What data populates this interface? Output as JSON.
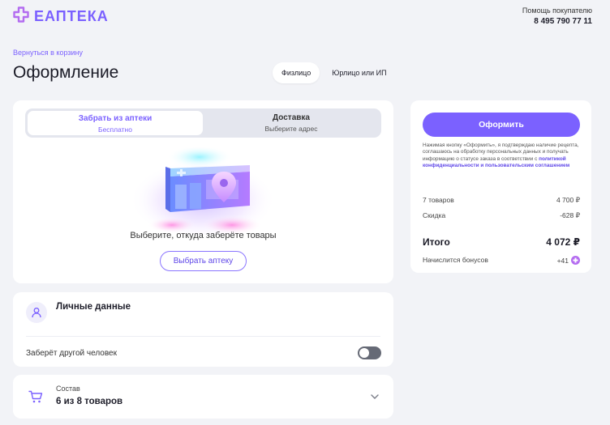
{
  "header": {
    "logo_text": "ЕАПТЕКА",
    "help_label": "Помощь покупателю",
    "phone": "8 495 790 77 11"
  },
  "breadcrumb": {
    "back_label": "Вернуться в корзину"
  },
  "page": {
    "title": "Оформление"
  },
  "person_tabs": [
    {
      "label": "Физлицо",
      "active": true
    },
    {
      "label": "Юрлицо или ИП",
      "active": false
    }
  ],
  "delivery": {
    "options": [
      {
        "title": "Забрать из аптеки",
        "subtitle": "Бесплатно",
        "active": true
      },
      {
        "title": "Доставка",
        "subtitle": "Выберите адрес",
        "active": false
      }
    ],
    "prompt": "Выберите, откуда заберёте товары",
    "choose_button": "Выбрать аптеку"
  },
  "personal": {
    "title": "Личные данные",
    "other_person_label": "Заберёт другой человек",
    "other_person_enabled": false
  },
  "contents": {
    "label": "Состав",
    "value": "6 из 8 товаров"
  },
  "summary": {
    "order_button": "Оформить",
    "legal_text": "Нажимая кнопку «Оформить», я подтверждаю наличие рецепта, соглашаюсь на обработку персональных данных и получать информацию о статусе заказа в соответствии с ",
    "legal_link": "политикой конфиденциальности и пользовательским соглашением",
    "rows": [
      {
        "label": "7 товаров",
        "value": "4 700 ₽"
      },
      {
        "label": "Скидка",
        "value": "-628 ₽"
      }
    ],
    "total_label": "Итого",
    "total_value": "4 072 ₽",
    "bonus_label": "Начислится бонусов",
    "bonus_value": "+41"
  },
  "colors": {
    "accent": "#7b61ff",
    "background": "#f2f3f7"
  }
}
